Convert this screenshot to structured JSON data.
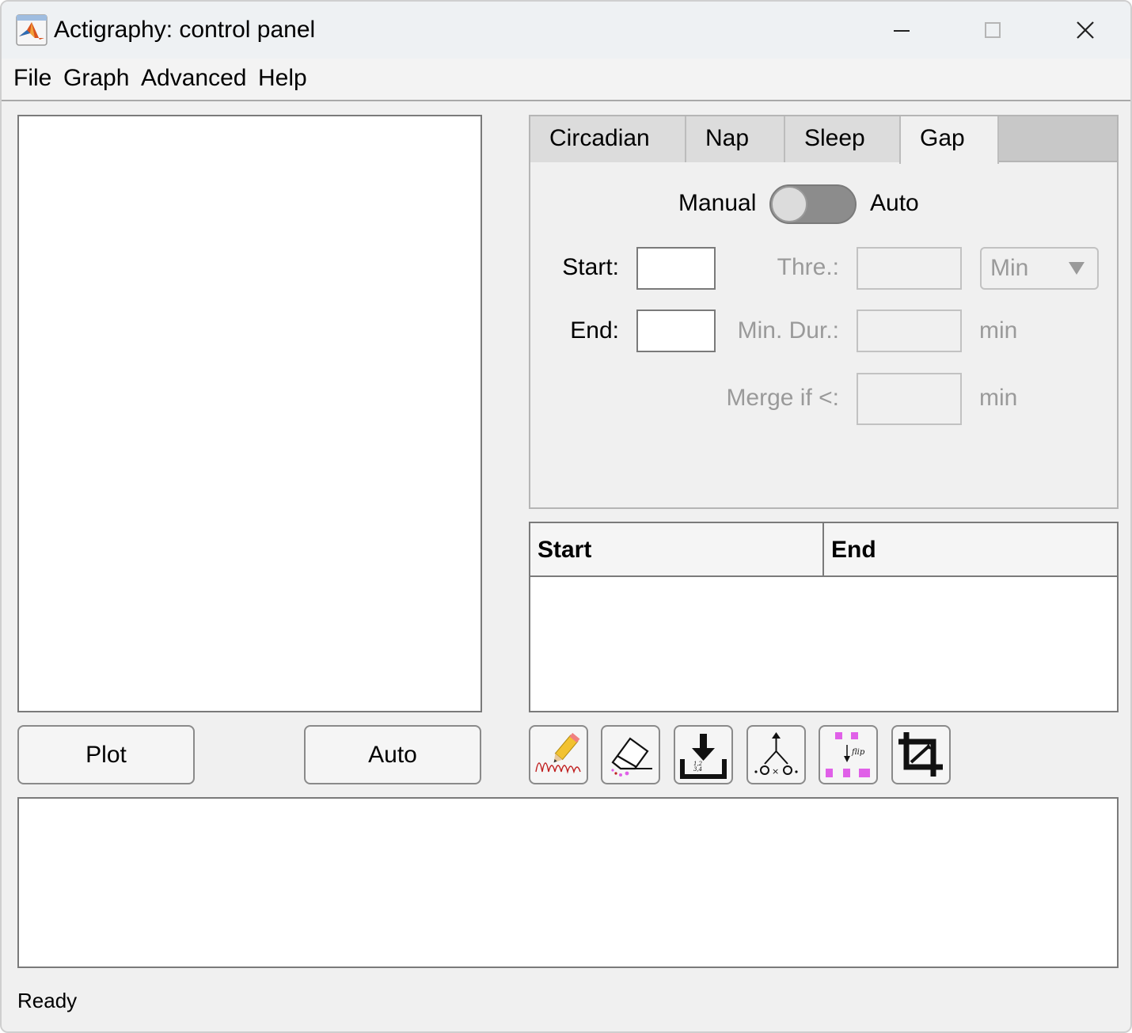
{
  "window": {
    "title": "Actigraphy: control panel",
    "controls": [
      "minimize",
      "maximize",
      "close"
    ]
  },
  "menu": [
    "File",
    "Graph",
    "Advanced",
    "Help"
  ],
  "tabs": [
    {
      "label": "Circadian",
      "active": false
    },
    {
      "label": "Nap",
      "active": false
    },
    {
      "label": "Sleep",
      "active": false
    },
    {
      "label": "Gap",
      "active": true
    }
  ],
  "gap_tab": {
    "toggle": {
      "left_label": "Manual",
      "right_label": "Auto",
      "state": "Manual"
    },
    "start_label": "Start:",
    "start_value": "",
    "end_label": "End:",
    "end_value": "",
    "threshold_label": "Thre.:",
    "threshold_value": "",
    "threshold_unit": "Min",
    "min_dur_label": "Min. Dur.:",
    "min_dur_value": "",
    "min_dur_unit": "min",
    "merge_label": "Merge if <:",
    "merge_value": "",
    "merge_unit": "min"
  },
  "table": {
    "columns": [
      "Start",
      "End"
    ],
    "rows": []
  },
  "buttons": {
    "plot": "Plot",
    "auto": "Auto"
  },
  "toolbar_icons": [
    "draw-icon",
    "erase-icon",
    "download-icon",
    "merge-icon",
    "flip-icon",
    "crop-icon"
  ],
  "log_text": "",
  "status": "Ready",
  "colors": {
    "accent_magenta": "#e060e8",
    "window_bg": "#f0f0f0",
    "disabled_text": "#9a9a9a"
  }
}
